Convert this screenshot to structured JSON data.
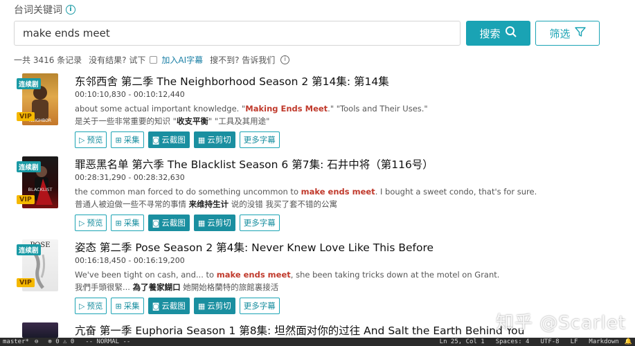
{
  "header": {
    "label": "台词关键词"
  },
  "search": {
    "value": "make ends meet",
    "button": "搜索",
    "filter": "筛选"
  },
  "stats": {
    "total": "一共 3416 条记录",
    "no_result": "没有结果? 试下",
    "ai_link": "加入AI字幕",
    "not_found": "搜不到? 告诉我们"
  },
  "badges": {
    "series": "连续剧",
    "vip": "VIP"
  },
  "actions": {
    "preview": "预览",
    "collect": "采集",
    "screenshot": "云截图",
    "clip": "云剪切",
    "more": "更多字幕"
  },
  "results": [
    {
      "title": "东邻西舍 第二季 The Neighborhood Season 2 第14集: 第14集",
      "time": "00:10:10,830 - 00:10:12,440",
      "en_pre": "about some actual important knowledge.  \"",
      "en_hl": "Making Ends Meet",
      "en_post": ".\" \"Tools and Their Uses.\"",
      "zh_pre": "是关于一些非常重要的知识 \"",
      "zh_hl": "收支平衡",
      "zh_post": "\" \"工具及其用途\""
    },
    {
      "title": "罪恶黑名单 第六季 The Blacklist Season 6 第7集: 石井中将（第116号）",
      "time": "00:28:31,290 - 00:28:32,630",
      "en_pre": "the common man forced to do something uncommon  to ",
      "en_hl": "make ends meet",
      "en_post": ". I bought a sweet condo, that's for sure.",
      "zh_pre": "普通人被迫做一些不寻常的事情  ",
      "zh_hl": "来维持生计",
      "zh_post": " 说的没错 我买了套不错的公寓"
    },
    {
      "title": "姿态 第二季 Pose Season 2 第4集: Never Knew Love Like This Before",
      "time": "00:16:18,450 - 00:16:19,200",
      "en_pre": "We've been tight on cash, and...  to ",
      "en_hl": "make ends meet",
      "en_post": ", she been taking tricks down at the motel on Grant.",
      "zh_pre": "我們手頭很緊...  ",
      "zh_hl": "為了養家餬口",
      "zh_post": " 她開始格蘭特的旅館裏接活"
    },
    {
      "title": "亢奋 第一季 Euphoria Season 1 第8集: 坦然面对你的过往 And Salt the Earth Behind You"
    }
  ],
  "watermark": "知乎 @Scarlet",
  "status_bar": {
    "branch": "master*",
    "sync": "⊖",
    "errors": "⊗ 0 ⚠ 0",
    "mode": "-- NORMAL --",
    "position": "Ln 25, Col 1",
    "spaces": "Spaces: 4",
    "encoding": "UTF-8",
    "eol": "LF",
    "language": "Markdown",
    "bell": "🔔"
  }
}
